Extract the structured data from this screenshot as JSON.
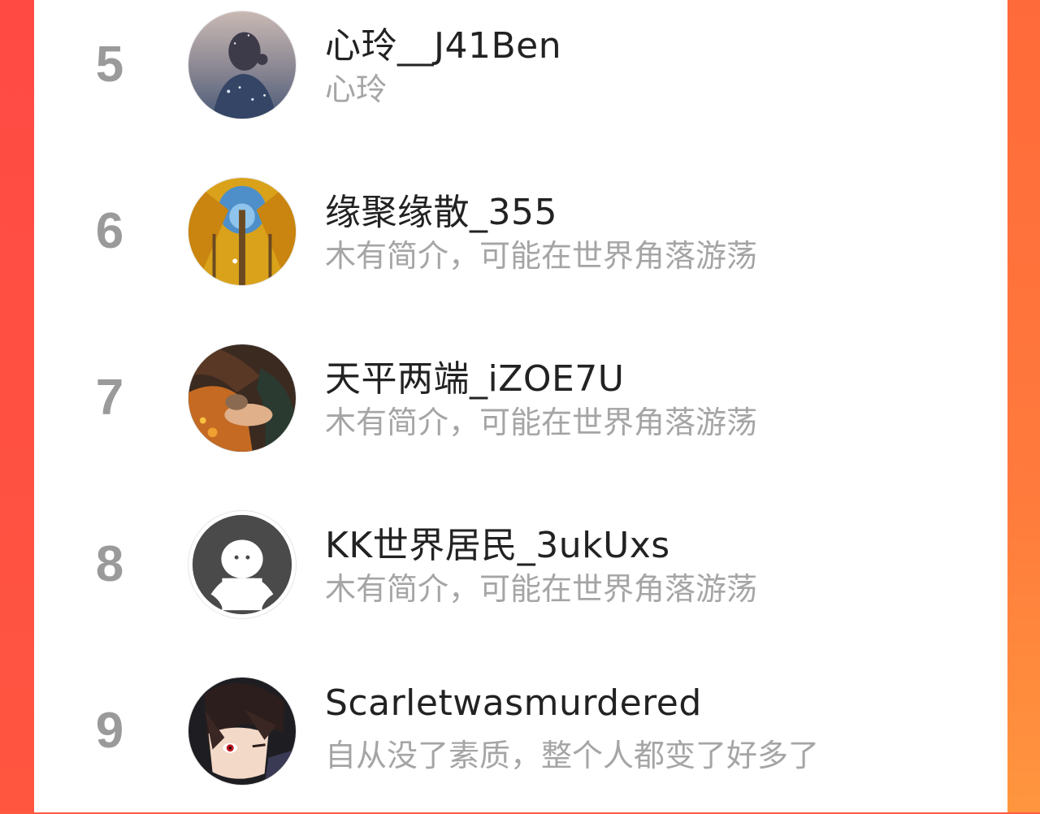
{
  "list": {
    "items": [
      {
        "rank": "5",
        "username": "心玲__J41Ben",
        "bio": "心玲",
        "avatar": "avatar-woman-starry-icon"
      },
      {
        "rank": "6",
        "username": "缘聚缘散_355",
        "bio": "木有简介，可能在世界角落游荡",
        "avatar": "avatar-autumn-trees-icon"
      },
      {
        "rank": "7",
        "username": "天平两端_iZOE7U",
        "bio": "木有简介，可能在世界角落游荡",
        "avatar": "avatar-hands-cat-icon"
      },
      {
        "rank": "8",
        "username": "KK世界居民_3ukUxs",
        "bio": "木有简介，可能在世界角落游荡",
        "avatar": "avatar-default-ghost-icon"
      },
      {
        "rank": "9",
        "username": "Scarletwasmurdered",
        "bio": "自从没了素质，整个人都变了好多了",
        "avatar": "avatar-anime-boy-icon"
      }
    ]
  },
  "colors": {
    "background_accent": "#ff5a43",
    "panel": "#ffffff",
    "rank_text": "#9a9a9a",
    "name_text": "#222222",
    "bio_text": "#a5a5a5"
  }
}
